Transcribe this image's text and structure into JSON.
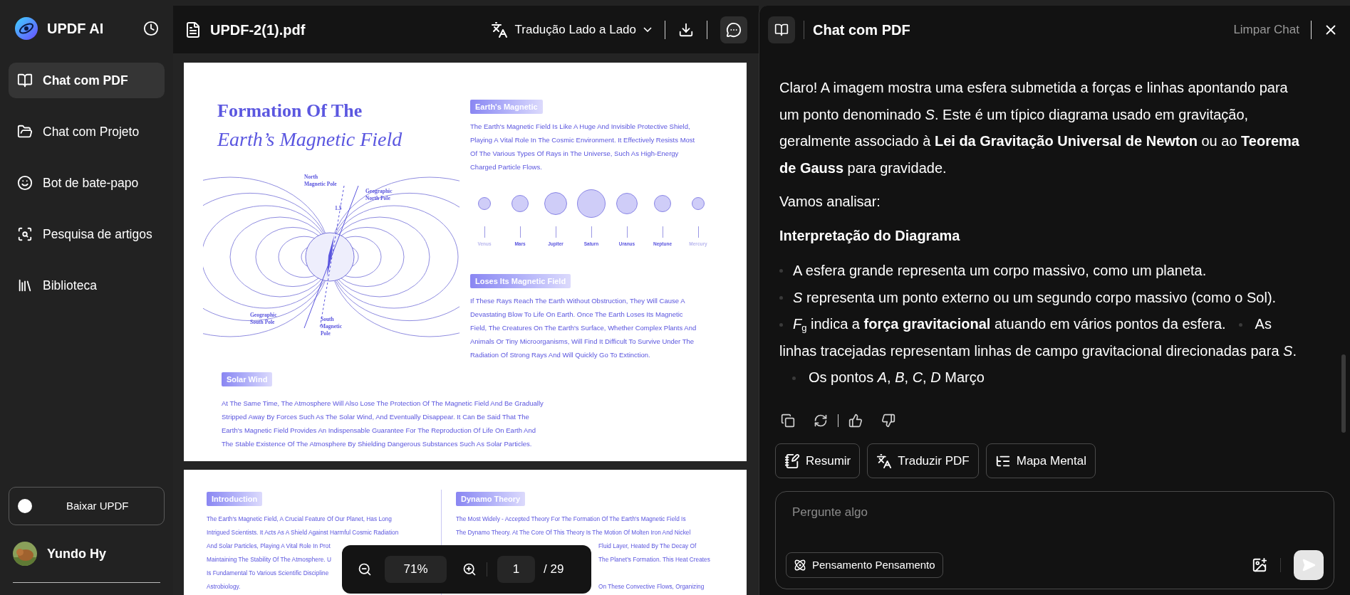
{
  "sidebar": {
    "brand": "UPDF AI",
    "items": [
      {
        "label": "Chat com PDF",
        "selected": true
      },
      {
        "label": "Chat com Projeto",
        "selected": false
      },
      {
        "label": "Bot de bate-papo",
        "selected": false
      },
      {
        "label": "Pesquisa de artigos",
        "selected": false
      },
      {
        "label": "Biblioteca",
        "selected": false
      }
    ],
    "download_button": "Baixar UPDF",
    "user_name": "Yundo Hy"
  },
  "viewer": {
    "file_name": "UPDF-2(1).pdf",
    "translate_mode": "Tradução Lado a Lado",
    "page_1": {
      "title_line_1": "Formation Of The",
      "title_line_2": "Earth’s Magnetic Field",
      "diagram_labels": [
        "North\nMagnetic Pole",
        "Geographic\nNorth Pole",
        "1.5",
        "Geographic\nSouth Pole",
        "South\nMagnetic\nPole"
      ],
      "sections": [
        {
          "heading": "Earth's Magnetic",
          "lines": [
            "The Earth's Magnetic Field Is Like A Huge And Invisible Protective Shield,",
            "Playing A Vital Role In The Cosmic Environment. It Effectively Resists Most",
            "Of The Various Types Of Rays in The Universe, Such As High-Energy",
            "Charged Particle Flows."
          ]
        },
        {
          "heading": "Loses Its Magnetic Field",
          "lines": [
            "If These Rays Reach The Earth Without Obstruction, They Will Cause A",
            "Devastating Blow To Life On Earth. Once The Earth Loses Its Magnetic",
            "Field, The Creatures On The Earth's Surface, Whether Complex Plants And",
            "Animals Or Tiny Microorganisms, Will Find It Difficult To Survive Under The",
            "Radiation Of Strong Rays And Will Quickly Go To Extinction."
          ]
        },
        {
          "heading": "Solar Wind",
          "lines": [
            "At The Same Time, The Atmosphere Will Also Lose The Protection Of The Magnetic Field And Be Gradually",
            "Stripped Away By Forces Such As The Solar Wind, And Eventually Disappear. It Can Be Said That The",
            "Earth's Magnetic Field Provides An Indispensable Guarantee For The Reproduction Of Life On Earth And",
            "The Stable Existence Of The Atmosphere By Shielding Dangerous Substances Such As Solar Particles."
          ]
        }
      ],
      "planets": [
        "Venus",
        "Mars",
        "Jupiter",
        "Saturn",
        "Uranus",
        "Neptune",
        "Mercury"
      ]
    },
    "page_2": {
      "columns": [
        {
          "heading": "Introduction",
          "lines": [
            {
              "text": "The Earth's Magnetic Field, A Crucial Feature Of Our Planet, Has Long",
              "kind": "full"
            },
            {
              "text": "Intrigued Scientists. It Acts As A Shield Against Harmful Cosmic Radiation",
              "kind": "full"
            },
            {
              "text": "And Solar Particles, Playing A Vital Role In Prot",
              "kind": "full"
            },
            {
              "text": "Maintaining The Stability Of The Atmosphere. U",
              "kind": "full"
            },
            {
              "text": "Is Fundamental To Various Scientific Discipline",
              "kind": "full"
            },
            {
              "text": "Astrobiology.",
              "kind": "full"
            }
          ]
        },
        {
          "heading": "Dynamo Theory",
          "lines": [
            {
              "text": "The Most Widely - Accepted Theory For The Formation Of The Earth's Magnetic Field Is",
              "kind": "full"
            },
            {
              "text": "The Dynamo Theory. At The Core Of This Theory Is The Motion Of Molten Iron And Nickel",
              "kind": "full"
            },
            {
              "text": "Fluid Layer, Heated By The Decay Of",
              "kind": "tail"
            },
            {
              "text": "The Planet's Formation. This Heat Creates",
              "kind": "tail"
            },
            {
              "text": "On These Convective Flows, Organizing",
              "kind": "tail-gap"
            }
          ]
        }
      ]
    },
    "zoom": "71%",
    "page": "1",
    "page_total": "/ 29"
  },
  "chat": {
    "title": "Chat com PDF",
    "clear": "Limpar Chat",
    "message": [
      {
        "kind": "paragraph",
        "text": "Claro! A imagem mostra uma esfera submetida a forças e linhas apontando para um ponto denominado *S*. Este é um típico diagrama usado em gravitação, geralmente associado à **Lei da Gravitação Universal de Newton** ou ao **Teorema de Gauss** para gravidade."
      },
      {
        "kind": "paragraph",
        "text": "Vamos analisar:"
      },
      {
        "kind": "heading",
        "text": "Interpretação do Diagrama"
      },
      {
        "kind": "bullet",
        "text": "A esfera grande representa um corpo massivo, como um planeta."
      },
      {
        "kind": "bullet",
        "text": "*S* representa um ponto externo ou um segundo corpo massivo (como o Sol)."
      },
      {
        "kind": "run",
        "parts": [
          "*F*$_{g}$ indica a **força gravitacional** atuando em vários pontos da esfera.",
          "As linhas tracejadas representam linhas de campo gravitacional direcionadas para *S*.",
          "Os pontos *A*, *B*, *C*, *D* Março"
        ]
      }
    ],
    "suggestions": [
      "Resumir",
      "Traduzir PDF",
      "Mapa Mental"
    ],
    "input_placeholder": "Pergunte algo",
    "mode_button": "Pensamento Pensamento"
  }
}
